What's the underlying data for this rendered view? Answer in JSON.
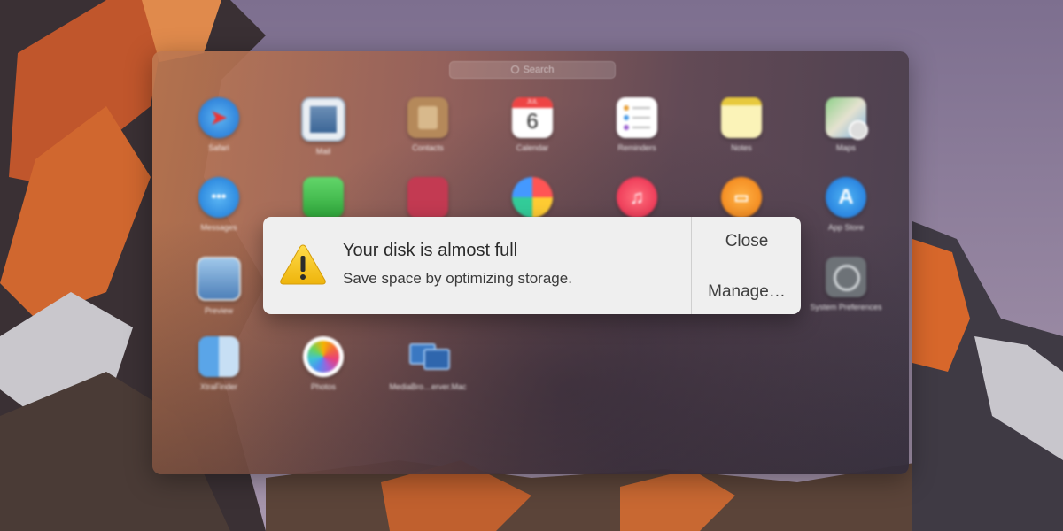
{
  "launchpad": {
    "search_placeholder": "Search",
    "apps": [
      {
        "label": "Safari"
      },
      {
        "label": "Mail"
      },
      {
        "label": "Contacts"
      },
      {
        "label": "Calendar",
        "day": "6",
        "month": "JUL"
      },
      {
        "label": "Reminders"
      },
      {
        "label": "Notes"
      },
      {
        "label": "Maps"
      },
      {
        "label": "Messages"
      },
      {
        "label": "App Store"
      },
      {
        "label": "Preview"
      },
      {
        "label": "System Preferences"
      },
      {
        "label": "XtraFinder"
      },
      {
        "label": "Photos"
      },
      {
        "label": "MediaBro…erver.Mac"
      }
    ]
  },
  "alert": {
    "title": "Your disk is almost full",
    "message": "Save space by optimizing storage.",
    "close_label": "Close",
    "manage_label": "Manage…"
  },
  "colors": {
    "alert_bg": "#efefef",
    "warning_yellow": "#f2c21b"
  }
}
